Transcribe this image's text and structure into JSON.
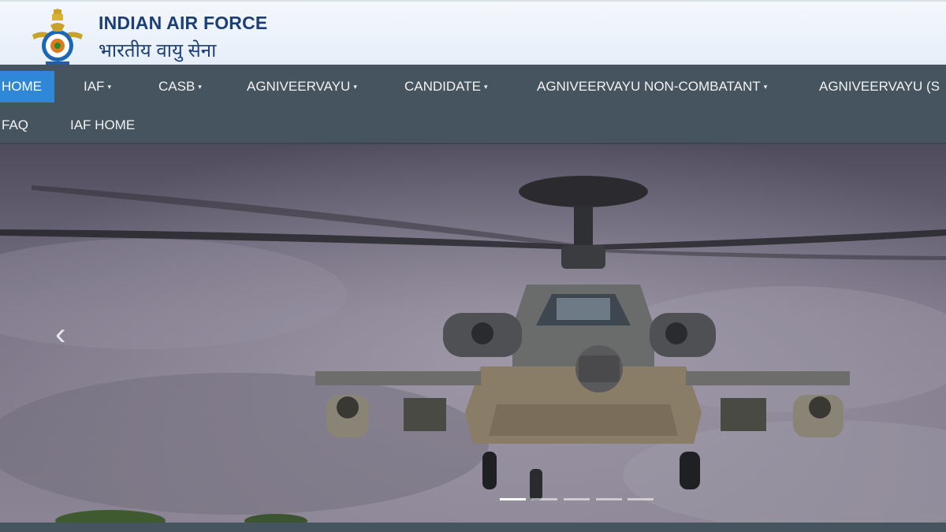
{
  "header": {
    "title_en": "INDIAN AIR FORCE",
    "title_hi": "भारतीय वायु सेना",
    "logo_icon": "iaf-emblem-icon"
  },
  "nav": {
    "items": [
      {
        "label": "HOME",
        "active": true,
        "dropdown": false
      },
      {
        "label": "IAF",
        "dropdown": true
      },
      {
        "label": "CASB",
        "dropdown": true
      },
      {
        "label": "AGNIVEERVAYU",
        "dropdown": true
      },
      {
        "label": "CANDIDATE",
        "dropdown": true
      },
      {
        "label": "AGNIVEERVAYU NON-COMBATANT",
        "dropdown": true
      },
      {
        "label": "AGNIVEERVAYU (S",
        "dropdown": false
      },
      {
        "label": "FAQ",
        "dropdown": false
      },
      {
        "label": "IAF HOME",
        "dropdown": false
      }
    ],
    "caret": "▾"
  },
  "slider": {
    "prev_icon": "chevron-left-icon",
    "prev_glyph": "‹",
    "slide_count": 5,
    "active_index": 0,
    "image_subject": "attack helicopter"
  },
  "colors": {
    "brand_blue": "#1d3f78",
    "nav_bg": "#46545f",
    "active_blue": "#2f87d8"
  }
}
